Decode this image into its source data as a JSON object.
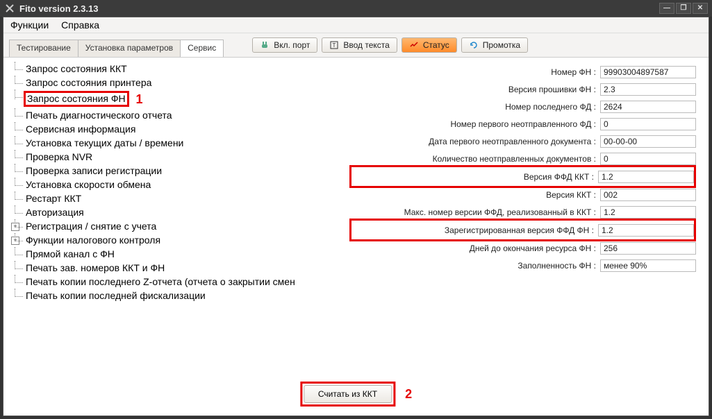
{
  "window": {
    "title": "Fito version 2.3.13"
  },
  "menubar": {
    "functions": "Функции",
    "help": "Справка"
  },
  "tabs": {
    "testing": "Тестирование",
    "params": "Установка параметров",
    "service": "Сервис"
  },
  "toolbar": {
    "port": "Вкл. порт",
    "text_input": "Ввод текста",
    "status": "Статус",
    "rewind": "Промотка"
  },
  "callouts": {
    "one": "1",
    "two": "2"
  },
  "tree": {
    "items": [
      "Запрос состояния ККТ",
      "Запрос состояния принтера",
      "Запрос состояния ФН",
      "Печать диагностического отчета",
      "Сервисная информация",
      "Установка текущих даты / времени",
      "Проверка NVR",
      "Проверка записи регистрации",
      "Установка скорости обмена",
      "Рестарт ККТ",
      "Авторизация",
      "Регистрация / снятие с учета",
      "Функции налогового контроля",
      "Прямой канал с ФН",
      "Печать зав. номеров ККТ и ФН",
      "Печать копии последнего Z-отчета (отчета о закрытии смен",
      "Печать копии последней фискализации"
    ]
  },
  "form": {
    "rows": [
      {
        "label": "Номер ФН :",
        "value": "99903004897587"
      },
      {
        "label": "Версия прошивки ФН :",
        "value": "2.3"
      },
      {
        "label": "Номер последнего ФД :",
        "value": "2624"
      },
      {
        "label": "Номер первого неотправленного ФД :",
        "value": "0"
      },
      {
        "label": "Дата первого неотправленного документа :",
        "value": "00-00-00"
      },
      {
        "label": "Количество неотправленных документов :",
        "value": "0"
      },
      {
        "label": "Версия ФФД ККТ :",
        "value": "1.2"
      },
      {
        "label": "Версия ККТ :",
        "value": "002"
      },
      {
        "label": "Макс. номер версии ФФД, реализованный в ККТ :",
        "value": "1.2"
      },
      {
        "label": "Зарегистрированная версия ФФД ФН :",
        "value": "1.2"
      },
      {
        "label": "Дней до окончания ресурса ФН :",
        "value": "256"
      },
      {
        "label": "Заполненность ФН :",
        "value": "менее 90%"
      }
    ]
  },
  "buttons": {
    "read": "Считать из ККТ"
  }
}
